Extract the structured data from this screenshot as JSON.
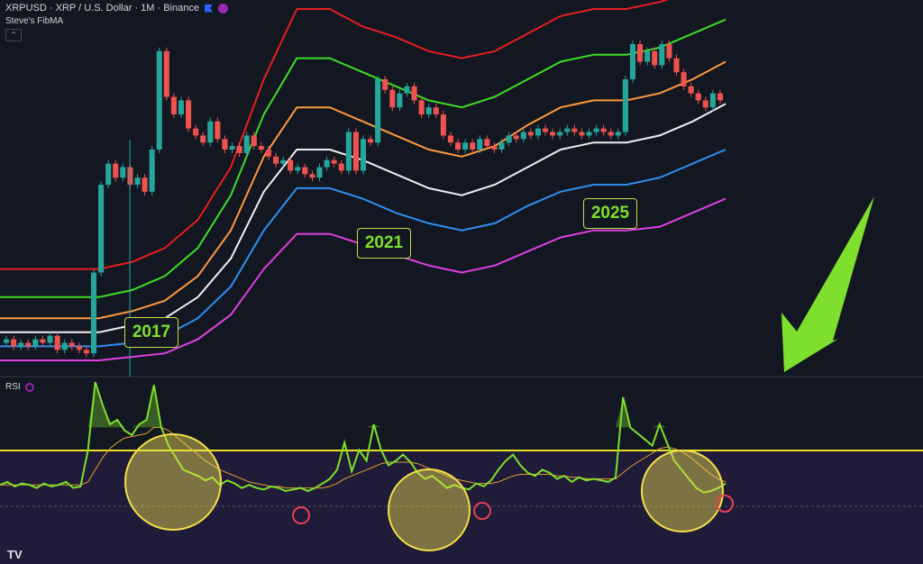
{
  "header": {
    "title": "XRPUSD · XRP / U.S. Dollar · 1M · Binance",
    "indicator": "Steve's FibMA",
    "collapse_symbol": "⌃"
  },
  "rsi_panel": {
    "label": "RSI"
  },
  "annotations": {
    "years": [
      "2017",
      "2021",
      "2025"
    ],
    "arrow_color": "#7ee02c"
  },
  "logo_text": "TV",
  "colors": {
    "background": "#131722",
    "up": "#26a69a",
    "down": "#ef5350",
    "band_red": "#e91e1e",
    "band_green": "#3ede24",
    "band_orange": "#ff9a3c",
    "band_white": "#f0f0f0",
    "band_blue": "#2f8ff0",
    "band_magenta": "#e040e0",
    "rsi": "#7ee02c",
    "rsi_ma": "#e0a030",
    "threshold": "#e8e025",
    "highlight": "#f4e04a",
    "marker": "#e84055"
  },
  "chart_data": [
    {
      "type": "candlestick",
      "title": "XRPUSD · XRP / U.S. Dollar · 1M · Binance",
      "ylabel": "",
      "xlabel": "",
      "bands": [
        {
          "name": "red",
          "color": "#e91e1e",
          "y": [
            0.26,
            0.26,
            0.26,
            0.26,
            0.28,
            0.32,
            0.4,
            0.55,
            0.8,
            1.0,
            1.0,
            0.95,
            0.92,
            0.88,
            0.86,
            0.88,
            0.93,
            0.98,
            1.0,
            1.0,
            1.02,
            1.05,
            1.1
          ]
        },
        {
          "name": "green",
          "color": "#3ede24",
          "y": [
            0.18,
            0.18,
            0.18,
            0.18,
            0.2,
            0.24,
            0.32,
            0.47,
            0.7,
            0.86,
            0.86,
            0.82,
            0.78,
            0.74,
            0.72,
            0.75,
            0.8,
            0.85,
            0.87,
            0.87,
            0.89,
            0.93,
            0.97
          ]
        },
        {
          "name": "orange",
          "color": "#ff9a3c",
          "y": [
            0.12,
            0.12,
            0.12,
            0.12,
            0.14,
            0.17,
            0.24,
            0.37,
            0.58,
            0.72,
            0.72,
            0.68,
            0.64,
            0.6,
            0.58,
            0.61,
            0.67,
            0.72,
            0.74,
            0.74,
            0.76,
            0.8,
            0.85
          ]
        },
        {
          "name": "white",
          "color": "#f0f0f0",
          "y": [
            0.08,
            0.08,
            0.08,
            0.08,
            0.1,
            0.12,
            0.18,
            0.29,
            0.48,
            0.6,
            0.6,
            0.57,
            0.53,
            0.49,
            0.47,
            0.5,
            0.55,
            0.6,
            0.62,
            0.62,
            0.64,
            0.68,
            0.73
          ]
        },
        {
          "name": "blue",
          "color": "#2f8ff0",
          "y": [
            0.04,
            0.04,
            0.04,
            0.04,
            0.05,
            0.07,
            0.12,
            0.21,
            0.37,
            0.49,
            0.49,
            0.46,
            0.42,
            0.39,
            0.37,
            0.39,
            0.44,
            0.48,
            0.5,
            0.5,
            0.52,
            0.56,
            0.6
          ]
        },
        {
          "name": "magenta",
          "color": "#e040e0",
          "y": [
            0.0,
            0.0,
            0.0,
            0.0,
            0.01,
            0.02,
            0.06,
            0.13,
            0.26,
            0.36,
            0.36,
            0.33,
            0.3,
            0.27,
            0.25,
            0.27,
            0.31,
            0.35,
            0.37,
            0.37,
            0.38,
            0.42,
            0.46
          ]
        }
      ],
      "candles": [
        {
          "o": 0.05,
          "c": 0.06
        },
        {
          "o": 0.06,
          "c": 0.04
        },
        {
          "o": 0.04,
          "c": 0.05
        },
        {
          "o": 0.05,
          "c": 0.04
        },
        {
          "o": 0.04,
          "c": 0.06
        },
        {
          "o": 0.06,
          "c": 0.05
        },
        {
          "o": 0.05,
          "c": 0.07
        },
        {
          "o": 0.07,
          "c": 0.03
        },
        {
          "o": 0.03,
          "c": 0.05
        },
        {
          "o": 0.05,
          "c": 0.04
        },
        {
          "o": 0.04,
          "c": 0.03
        },
        {
          "o": 0.03,
          "c": 0.02
        },
        {
          "o": 0.02,
          "c": 0.25
        },
        {
          "o": 0.25,
          "c": 0.5
        },
        {
          "o": 0.5,
          "c": 0.56
        },
        {
          "o": 0.56,
          "c": 0.52
        },
        {
          "o": 0.52,
          "c": 0.55
        },
        {
          "o": 0.55,
          "c": 0.5
        },
        {
          "o": 0.5,
          "c": 0.52
        },
        {
          "o": 0.52,
          "c": 0.48
        },
        {
          "o": 0.48,
          "c": 0.6
        },
        {
          "o": 0.6,
          "c": 0.88
        },
        {
          "o": 0.88,
          "c": 0.75
        },
        {
          "o": 0.75,
          "c": 0.7
        },
        {
          "o": 0.7,
          "c": 0.74
        },
        {
          "o": 0.74,
          "c": 0.66
        },
        {
          "o": 0.66,
          "c": 0.64
        },
        {
          "o": 0.64,
          "c": 0.62
        },
        {
          "o": 0.62,
          "c": 0.68
        },
        {
          "o": 0.68,
          "c": 0.63
        },
        {
          "o": 0.63,
          "c": 0.6
        },
        {
          "o": 0.6,
          "c": 0.61
        },
        {
          "o": 0.61,
          "c": 0.59
        },
        {
          "o": 0.59,
          "c": 0.64
        },
        {
          "o": 0.64,
          "c": 0.61
        },
        {
          "o": 0.61,
          "c": 0.6
        },
        {
          "o": 0.6,
          "c": 0.58
        },
        {
          "o": 0.58,
          "c": 0.56
        },
        {
          "o": 0.56,
          "c": 0.57
        },
        {
          "o": 0.57,
          "c": 0.54
        },
        {
          "o": 0.54,
          "c": 0.55
        },
        {
          "o": 0.55,
          "c": 0.53
        },
        {
          "o": 0.53,
          "c": 0.52
        },
        {
          "o": 0.52,
          "c": 0.55
        },
        {
          "o": 0.55,
          "c": 0.57
        },
        {
          "o": 0.57,
          "c": 0.56
        },
        {
          "o": 0.56,
          "c": 0.54
        },
        {
          "o": 0.54,
          "c": 0.65
        },
        {
          "o": 0.65,
          "c": 0.54
        },
        {
          "o": 0.54,
          "c": 0.63
        },
        {
          "o": 0.63,
          "c": 0.62
        },
        {
          "o": 0.62,
          "c": 0.8
        },
        {
          "o": 0.8,
          "c": 0.77
        },
        {
          "o": 0.77,
          "c": 0.72
        },
        {
          "o": 0.72,
          "c": 0.76
        },
        {
          "o": 0.76,
          "c": 0.78
        },
        {
          "o": 0.78,
          "c": 0.74
        },
        {
          "o": 0.74,
          "c": 0.7
        },
        {
          "o": 0.7,
          "c": 0.72
        },
        {
          "o": 0.72,
          "c": 0.7
        },
        {
          "o": 0.7,
          "c": 0.64
        },
        {
          "o": 0.64,
          "c": 0.62
        },
        {
          "o": 0.62,
          "c": 0.6
        },
        {
          "o": 0.6,
          "c": 0.62
        },
        {
          "o": 0.62,
          "c": 0.6
        },
        {
          "o": 0.6,
          "c": 0.63
        },
        {
          "o": 0.63,
          "c": 0.61
        },
        {
          "o": 0.61,
          "c": 0.6
        },
        {
          "o": 0.6,
          "c": 0.62
        },
        {
          "o": 0.62,
          "c": 0.64
        },
        {
          "o": 0.64,
          "c": 0.63
        },
        {
          "o": 0.63,
          "c": 0.65
        },
        {
          "o": 0.65,
          "c": 0.64
        },
        {
          "o": 0.64,
          "c": 0.66
        },
        {
          "o": 0.66,
          "c": 0.65
        },
        {
          "o": 0.65,
          "c": 0.64
        },
        {
          "o": 0.64,
          "c": 0.65
        },
        {
          "o": 0.65,
          "c": 0.66
        },
        {
          "o": 0.66,
          "c": 0.65
        },
        {
          "o": 0.65,
          "c": 0.64
        },
        {
          "o": 0.64,
          "c": 0.65
        },
        {
          "o": 0.65,
          "c": 0.66
        },
        {
          "o": 0.66,
          "c": 0.65
        },
        {
          "o": 0.65,
          "c": 0.64
        },
        {
          "o": 0.64,
          "c": 0.65
        },
        {
          "o": 0.65,
          "c": 0.8
        },
        {
          "o": 0.8,
          "c": 0.9
        },
        {
          "o": 0.9,
          "c": 0.85
        },
        {
          "o": 0.85,
          "c": 0.88
        },
        {
          "o": 0.88,
          "c": 0.84
        },
        {
          "o": 0.84,
          "c": 0.9
        },
        {
          "o": 0.9,
          "c": 0.86
        },
        {
          "o": 0.86,
          "c": 0.82
        },
        {
          "o": 0.82,
          "c": 0.78
        },
        {
          "o": 0.78,
          "c": 0.76
        },
        {
          "o": 0.76,
          "c": 0.74
        },
        {
          "o": 0.74,
          "c": 0.72
        },
        {
          "o": 0.72,
          "c": 0.76
        },
        {
          "o": 0.76,
          "c": 0.74
        }
      ]
    },
    {
      "type": "line",
      "title": "RSI",
      "threshold_level": 0.7,
      "series": [
        {
          "name": "RSI",
          "color": "#7ee02c",
          "values": [
            0.32,
            0.34,
            0.31,
            0.33,
            0.32,
            0.3,
            0.33,
            0.31,
            0.32,
            0.34,
            0.3,
            0.31,
            0.55,
            1.0,
            0.85,
            0.72,
            0.75,
            0.68,
            0.65,
            0.72,
            0.75,
            0.98,
            0.7,
            0.58,
            0.5,
            0.42,
            0.4,
            0.38,
            0.35,
            0.37,
            0.32,
            0.35,
            0.33,
            0.3,
            0.32,
            0.3,
            0.29,
            0.31,
            0.3,
            0.28,
            0.29,
            0.3,
            0.28,
            0.3,
            0.33,
            0.36,
            0.42,
            0.6,
            0.41,
            0.55,
            0.48,
            0.72,
            0.55,
            0.45,
            0.48,
            0.52,
            0.47,
            0.4,
            0.36,
            0.38,
            0.34,
            0.3,
            0.32,
            0.3,
            0.29,
            0.33,
            0.31,
            0.35,
            0.42,
            0.48,
            0.52,
            0.45,
            0.4,
            0.38,
            0.42,
            0.4,
            0.36,
            0.38,
            0.34,
            0.37,
            0.35,
            0.36,
            0.35,
            0.34,
            0.37,
            0.9,
            0.7,
            0.66,
            0.62,
            0.58,
            0.72,
            0.6,
            0.48,
            0.42,
            0.36,
            0.3,
            0.27,
            0.28,
            0.3,
            0.33
          ]
        },
        {
          "name": "RSI MA",
          "color": "#e0a030",
          "values": [
            0.32,
            0.32,
            0.32,
            0.32,
            0.32,
            0.32,
            0.32,
            0.32,
            0.32,
            0.32,
            0.32,
            0.32,
            0.34,
            0.42,
            0.5,
            0.56,
            0.6,
            0.63,
            0.64,
            0.65,
            0.66,
            0.7,
            0.7,
            0.68,
            0.64,
            0.6,
            0.56,
            0.52,
            0.48,
            0.45,
            0.42,
            0.4,
            0.38,
            0.36,
            0.34,
            0.33,
            0.32,
            0.31,
            0.31,
            0.3,
            0.3,
            0.3,
            0.3,
            0.3,
            0.3,
            0.31,
            0.33,
            0.36,
            0.38,
            0.4,
            0.42,
            0.44,
            0.46,
            0.47,
            0.47,
            0.47,
            0.47,
            0.46,
            0.44,
            0.42,
            0.4,
            0.38,
            0.36,
            0.35,
            0.34,
            0.33,
            0.33,
            0.33,
            0.34,
            0.36,
            0.38,
            0.39,
            0.39,
            0.39,
            0.39,
            0.39,
            0.38,
            0.38,
            0.37,
            0.37,
            0.36,
            0.36,
            0.36,
            0.36,
            0.36,
            0.4,
            0.44,
            0.47,
            0.5,
            0.53,
            0.56,
            0.57,
            0.56,
            0.54,
            0.51,
            0.47,
            0.43,
            0.39,
            0.36,
            0.34
          ]
        }
      ]
    }
  ]
}
